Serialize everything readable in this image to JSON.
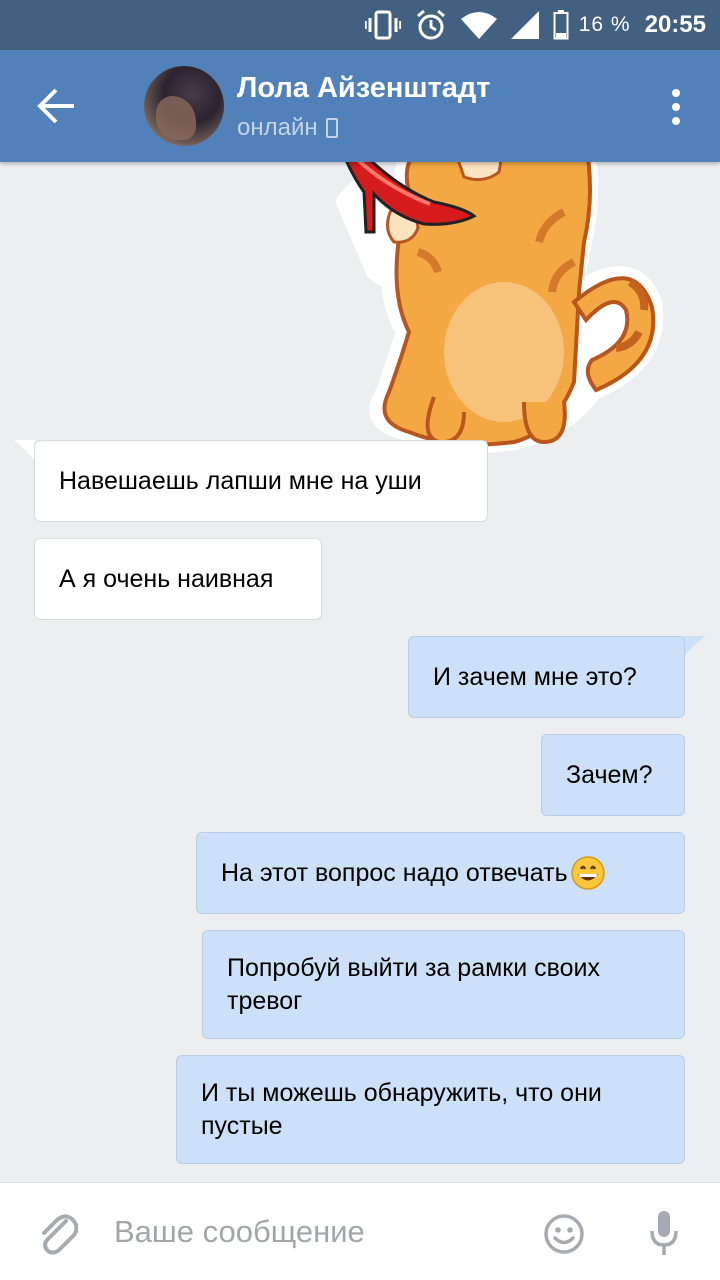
{
  "status_bar": {
    "battery": "16 %",
    "time": "20:55",
    "icons": [
      "vibrate-icon",
      "alarm-icon",
      "wifi-icon",
      "signal-icon",
      "battery-icon"
    ]
  },
  "header": {
    "name": "Лола Айзенштадт",
    "status": "онлайн",
    "icons": [
      "back-arrow-icon",
      "avatar",
      "mobile-phone-icon",
      "more-vertical-icon"
    ],
    "accent_color": "#5181b8"
  },
  "messages": [
    {
      "direction": "in",
      "type": "sticker",
      "sticker": "cat-holding-red-shoe"
    },
    {
      "direction": "in",
      "text": "Навешаешь лапши мне на уши"
    },
    {
      "direction": "in",
      "text": "А я очень наивная"
    },
    {
      "direction": "out",
      "text": "И зачем мне это?"
    },
    {
      "direction": "out",
      "text": "Зачем?"
    },
    {
      "direction": "out",
      "text": "На этот вопрос надо отвечать",
      "emoji": "grinning-face-icon"
    },
    {
      "direction": "out",
      "text": "Попробуй выйти за рамки своих тревог"
    },
    {
      "direction": "out",
      "text": "И ты можешь обнаружить, что они пустые"
    }
  ],
  "input_bar": {
    "placeholder": "Ваше сообщение",
    "icons": [
      "paperclip-icon",
      "smile-icon",
      "microphone-icon"
    ]
  },
  "colors": {
    "status_bar": "#42607f",
    "incoming_bubble": "#ffffff",
    "outgoing_bubble": "#cce0f7",
    "chat_background": "#edeef0"
  }
}
